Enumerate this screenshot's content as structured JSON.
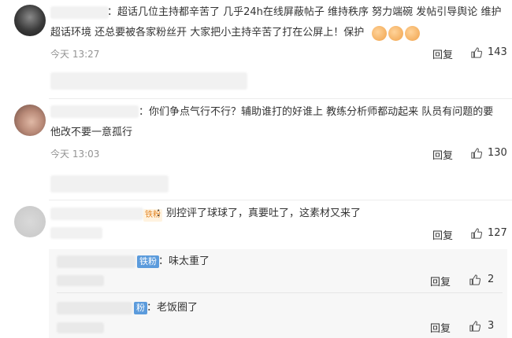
{
  "comments": [
    {
      "text_line1": "：超话几位主持都辛苦了 几乎24h在线屏蔽帖子 维持秩序 努力端碗 发帖引导舆论 维护",
      "text_line2": "超话环境 还总要被各家粉丝开 大家把小主持辛苦了打在公屏上！保护",
      "time": "今天 13:27",
      "reply_label": "回复",
      "likes": "143"
    },
    {
      "text_line1": "：你们争点气行不行？辅助谁打的好谁上 教练分析师都动起来 队员有问题的要",
      "text_line2": "他改不要一意孤行",
      "time": "今天 13:03",
      "reply_label": "回复",
      "likes": "130"
    },
    {
      "text_line1": "：别控评了球球了，真要吐了，这素材又来了",
      "badge": "铁粉",
      "reply_label": "回复",
      "likes": "127",
      "replies": [
        {
          "badge": "铁粉",
          "text": "：味太重了",
          "reply_label": "回复",
          "likes": "2"
        },
        {
          "badge": "粉",
          "text": "：老饭圈了",
          "reply_label": "回复",
          "likes": "3"
        }
      ]
    }
  ],
  "icons": {
    "like": "thumbs-up-icon",
    "emoji": "fist-emoji-icon"
  }
}
